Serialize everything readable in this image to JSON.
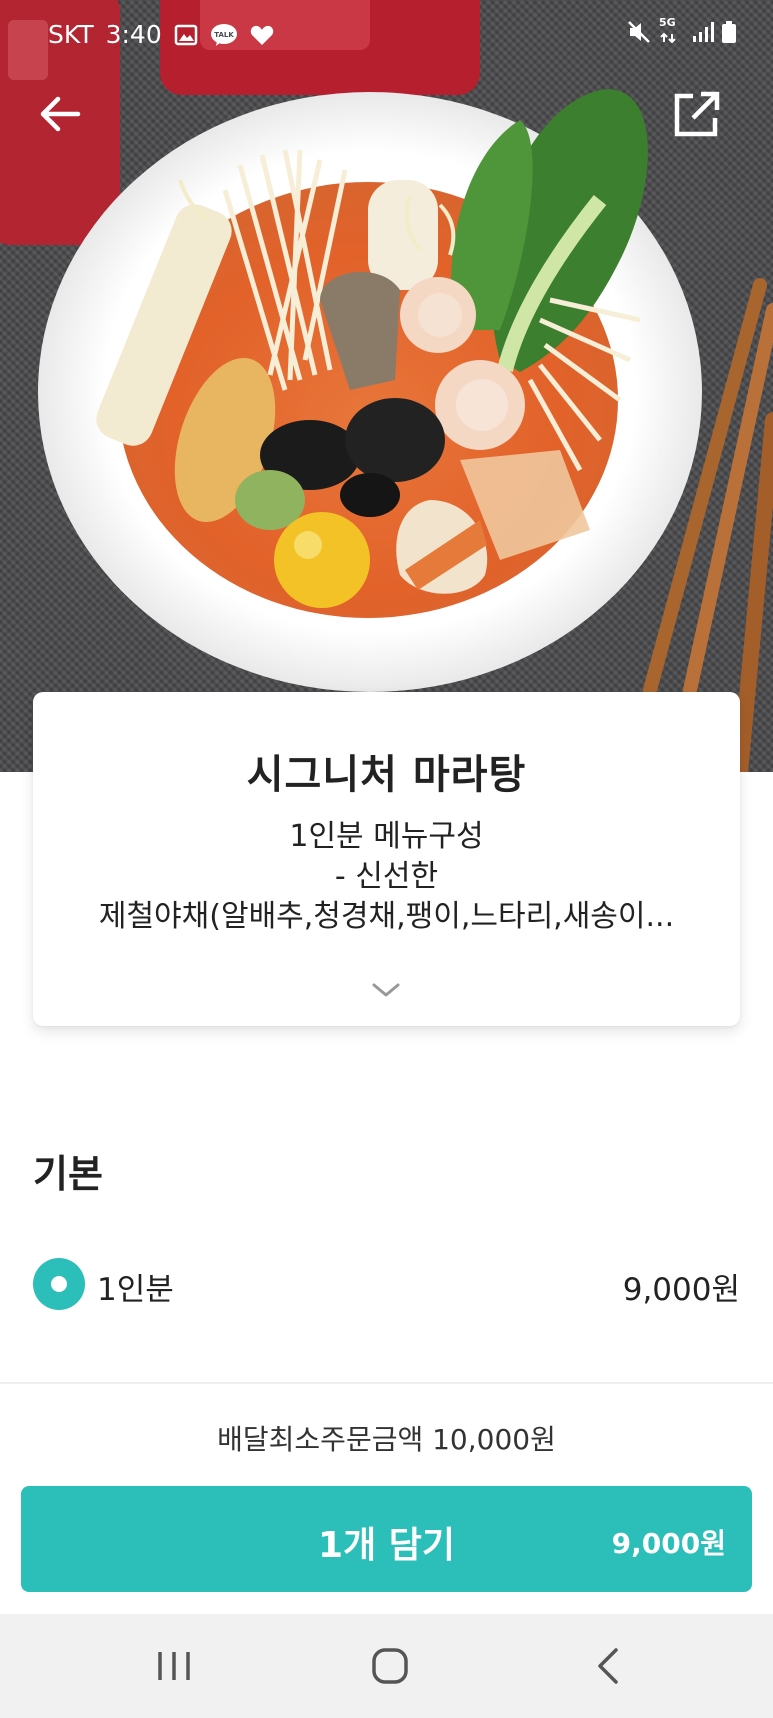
{
  "status_bar": {
    "carrier": "SKT",
    "time": "3:40",
    "icons_left": [
      "gallery-icon",
      "talk-icon",
      "heart-icon"
    ],
    "icons_right": [
      "mute-icon",
      "5g-icon",
      "signal-icon",
      "battery-icon"
    ],
    "network_badge": "5G"
  },
  "header": {
    "back_icon": "arrow-left-icon",
    "share_icon": "external-share-icon"
  },
  "menu": {
    "title": "시그니처 마라탕",
    "description_lines": [
      "1인분 메뉴구성",
      "- 신선한",
      "제철야채(알배추,청경채,팽이,느타리,새송이..."
    ],
    "expand_icon": "chevron-down-icon"
  },
  "options": {
    "section_title": "기본",
    "items": [
      {
        "label": "1인분",
        "price": "9,000원",
        "selected": true
      }
    ]
  },
  "footer": {
    "min_order": "배달최소주문금액 10,000원",
    "add_button_label": "1개 담기",
    "add_button_price": "9,000원"
  },
  "nav": {
    "icons": [
      "recents-icon",
      "home-icon",
      "back-icon"
    ]
  },
  "colors": {
    "accent": "#2cbfb9",
    "card_bg": "#ffffff",
    "nav_bg": "#f1f1f1"
  }
}
